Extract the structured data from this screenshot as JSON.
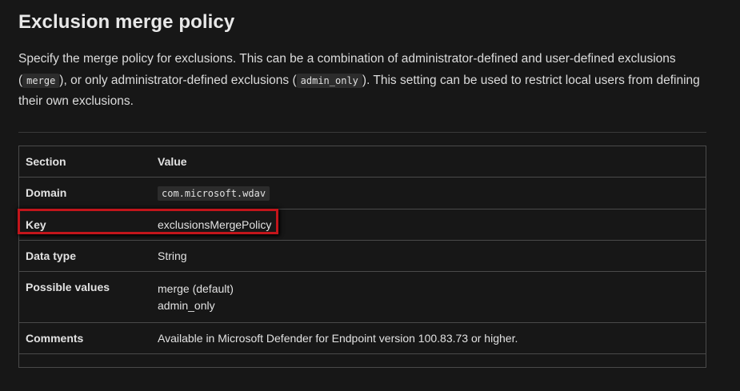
{
  "heading": "Exclusion merge policy",
  "description": {
    "part1": "Specify the merge policy for exclusions. This can be a combination of administrator-defined and user-defined exclusions (",
    "code1": "merge",
    "part2": "), or only administrator-defined exclusions (",
    "code2": "admin_only",
    "part3": "). This setting can be used to restrict local users from defining their own exclusions."
  },
  "table": {
    "headers": {
      "section": "Section",
      "value": "Value"
    },
    "domain": {
      "label": "Domain",
      "value": "com.microsoft.wdav"
    },
    "key": {
      "label": "Key",
      "value": "exclusionsMergePolicy"
    },
    "data_type": {
      "label": "Data type",
      "value": "String"
    },
    "possible_values": {
      "label": "Possible values",
      "values": [
        "merge (default)",
        "admin_only"
      ]
    },
    "comments": {
      "label": "Comments",
      "value": "Available in Microsoft Defender for Endpoint version 100.83.73 or higher."
    }
  },
  "colors": {
    "background": "#171717",
    "highlight": "#c2151b",
    "text": "#e6e6e6"
  }
}
